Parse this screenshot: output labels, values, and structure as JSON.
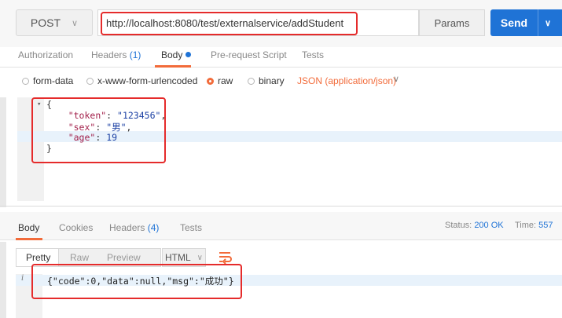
{
  "request": {
    "method": "POST",
    "url": "http://localhost:8080/test/externalservice/addStudent",
    "params_label": "Params",
    "send_label": "Send"
  },
  "request_tabs": {
    "authorization": "Authorization",
    "headers": "Headers",
    "headers_count": "(1)",
    "body": "Body",
    "prerequest": "Pre-request Script",
    "tests": "Tests"
  },
  "body_types": {
    "form_data": "form-data",
    "urlencoded": "x-www-form-urlencoded",
    "raw": "raw",
    "binary": "binary",
    "json_type": "JSON (application/json)"
  },
  "editor": {
    "open": "{",
    "k_token": "\"token\"",
    "v_token": "\"123456\"",
    "k_sex": "\"sex\"",
    "v_sex": "\"男\"",
    "k_age": "\"age\"",
    "v_age": "19",
    "close": "}"
  },
  "response_tabs": {
    "body": "Body",
    "cookies": "Cookies",
    "headers": "Headers",
    "headers_count": "(4)",
    "tests": "Tests"
  },
  "response_status": {
    "status_label": "Status:",
    "status_value": "200 OK",
    "time_label": "Time:",
    "time_value": "557"
  },
  "response_view": {
    "pretty": "Pretty",
    "raw": "Raw",
    "preview": "Preview",
    "format": "HTML"
  },
  "response_body": "{\"code\":0,\"data\":null,\"msg\":\"成功\"}",
  "colors": {
    "accent": "#f26b3a",
    "send": "#1f73d6",
    "highlight_box": "#e52b2b"
  }
}
